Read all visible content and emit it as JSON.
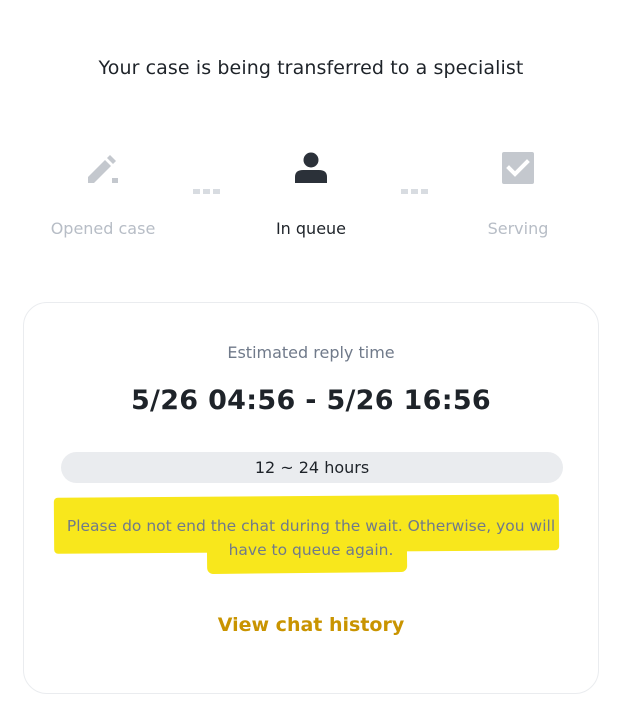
{
  "header": {
    "title": "Your case is being transferred to a specialist"
  },
  "steps": [
    {
      "label": "Opened case",
      "icon": "edit-icon",
      "state": "done"
    },
    {
      "label": "In queue",
      "icon": "user-icon",
      "state": "active"
    },
    {
      "label": "Serving",
      "icon": "checkbox-icon",
      "state": "pending"
    }
  ],
  "card": {
    "estimate_label": "Estimated reply time",
    "time_range": "5/26 04:56 - 5/26 16:56",
    "duration": "12 ~ 24 hours",
    "warning": "Please do not end the chat during the wait. Otherwise, you will have to queue again.",
    "history_link": "View chat history"
  },
  "colors": {
    "accent": "#c99400",
    "highlight": "#f8e71c",
    "text_primary": "#1e2329",
    "text_secondary": "#707a8a",
    "text_muted": "#b7bdc6"
  }
}
